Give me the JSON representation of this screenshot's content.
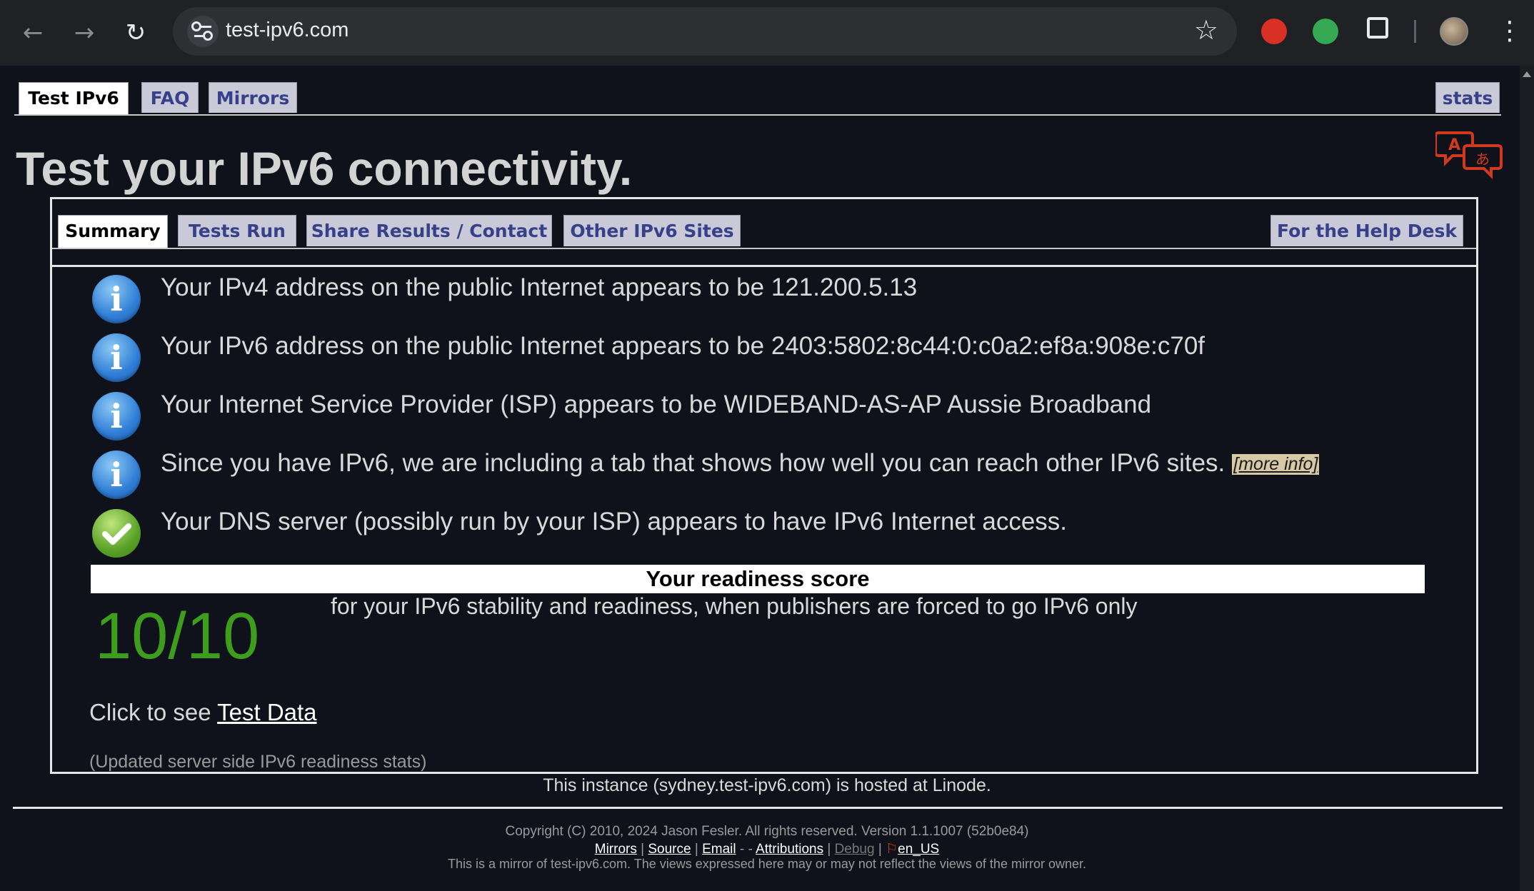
{
  "browser": {
    "url": "test-ipv6.com",
    "back_icon": "arrow-left-icon",
    "forward_icon": "arrow-right-icon",
    "reload_icon": "reload-icon",
    "bookmark_icon": "star-icon",
    "extensions": [
      "red-hand-extension",
      "green-refresh-extension",
      "puzzle-extensions-icon"
    ],
    "menu_icon": "kebab-icon"
  },
  "site_tabs": [
    {
      "label": "Test IPv6",
      "active": true
    },
    {
      "label": "FAQ",
      "active": false
    },
    {
      "label": "Mirrors",
      "active": false
    }
  ],
  "stats_tab": "stats",
  "page_title": "Test your IPv6 connectivity.",
  "inner_tabs": [
    {
      "label": "Summary",
      "active": true
    },
    {
      "label": "Tests Run",
      "active": false
    },
    {
      "label": "Share Results / Contact",
      "active": false
    },
    {
      "label": "Other IPv6 Sites",
      "active": false
    }
  ],
  "help_desk_tab": "For the Help Desk",
  "results": [
    {
      "icon": "info-icon",
      "text": "Your IPv4 address on the public Internet appears to be 121.200.5.13"
    },
    {
      "icon": "info-icon",
      "text": "Your IPv6 address on the public Internet appears to be 2403:5802:8c44:0:c0a2:ef8a:908e:c70f"
    },
    {
      "icon": "info-icon",
      "text": "Your Internet Service Provider (ISP) appears to be WIDEBAND-AS-AP Aussie Broadband"
    },
    {
      "icon": "info-icon",
      "text": "Since you have IPv6, we are including a tab that shows how well you can reach other IPv6 sites.",
      "link": "[more info]"
    },
    {
      "icon": "check-icon",
      "text": "Your DNS server (possibly run by your ISP) appears to have IPv6 Internet access."
    }
  ],
  "readiness": {
    "heading": "Your readiness score",
    "score": "10/10",
    "description": "for your IPv6 stability and readiness, when publishers are forced to go IPv6 only",
    "score_color": "#3f9d1e"
  },
  "test_data": {
    "prefix": "Click to see ",
    "link": "Test Data"
  },
  "updated_stats": "(Updated server side IPv6 readiness stats)",
  "hosted": "This instance (sydney.test-ipv6.com) is hosted at Linode.",
  "footer": {
    "copyright": "Copyright (C) 2010, 2024 Jason Fesler. All rights reserved. Version 1.1.1007 (52b0e84)",
    "links": [
      "Mirrors",
      "Source",
      "Email",
      "Attributions",
      "Debug",
      "en_US"
    ],
    "mirror_note": "This is a mirror of test-ipv6.com. The views expressed here may or may not reflect the views of the mirror owner."
  }
}
